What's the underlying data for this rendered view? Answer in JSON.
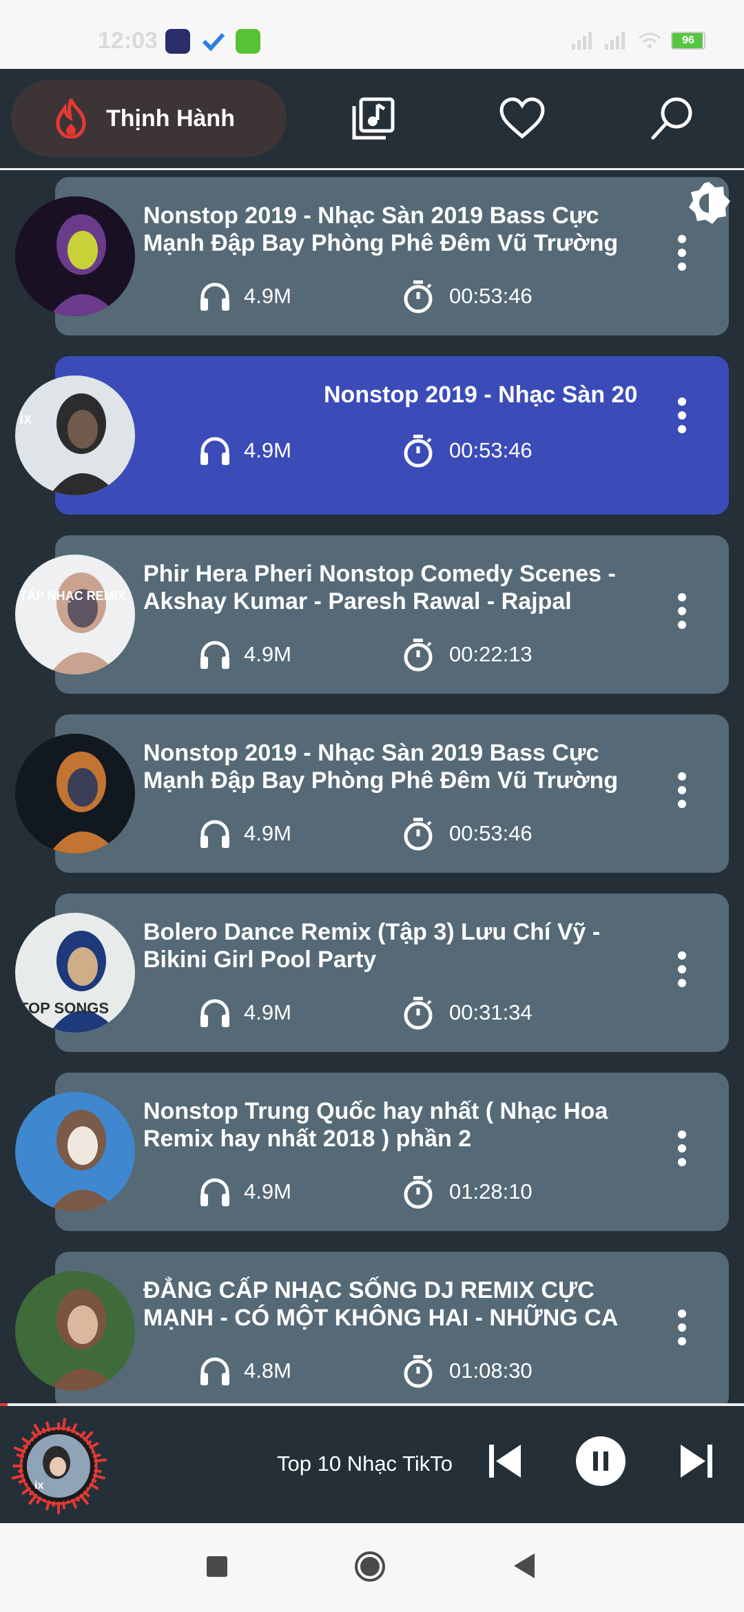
{
  "status_bar": {
    "time": "12:03",
    "battery": "96",
    "battery_level": 0.96,
    "apps": [
      "game-app-icon",
      "check-app-icon",
      "android-app-icon"
    ]
  },
  "header": {
    "active_tab": "Thịnh Hành",
    "icons": [
      "fire-icon",
      "music-library-icon",
      "heart-icon",
      "search-icon"
    ]
  },
  "songs": [
    {
      "title": "Nonstop 2019 - Nhạc Sàn 2019 Bass Cực Mạnh Đập Bay Phòng Phê Đêm Vũ Trường",
      "plays": "4.9M",
      "duration": "00:53:46",
      "active": false
    },
    {
      "title": "Nonstop 2019 - Nhạc Sàn 20",
      "plays": "4.9M",
      "duration": "00:53:46",
      "active": true
    },
    {
      "title": "Phir Hera Pheri Nonstop Comedy Scenes - Akshay Kumar - Paresh Rawal - Rajpal Yada...",
      "plays": "4.9M",
      "duration": "00:22:13",
      "active": false
    },
    {
      "title": "Nonstop 2019 - Nhạc Sàn 2019 Bass Cực Mạnh Đập Bay Phòng Phê Đêm Vũ Trường",
      "plays": "4.9M",
      "duration": "00:53:46",
      "active": false
    },
    {
      "title": "Bolero Dance Remix (Tập 3) Lưu Chí Vỹ - Bikini Girl Pool Party",
      "plays": "4.9M",
      "duration": "00:31:34",
      "active": false
    },
    {
      "title": "Nonstop Trung Quốc hay nhất ( Nhạc Hoa Remix hay nhất 2018 ) phần 2",
      "plays": "4.9M",
      "duration": "01:28:10",
      "active": false
    },
    {
      "title": "ĐẲNG CẤP NHẠC SỐNG DJ REMIX CỰC MẠNH - CÓ MỘT KHÔNG HAI - NHỮNG CA ...",
      "plays": "4.8M",
      "duration": "01:08:30",
      "active": false
    }
  ],
  "thumb_labels": [
    "",
    "ix",
    "TẬP NHẠC REMIX",
    "",
    "TOP SONGS",
    "",
    ""
  ],
  "player": {
    "now_playing": "Top 10 Nhạc TikTo",
    "progress": 0.01,
    "controls": [
      "previous-icon",
      "pause-icon",
      "next-icon"
    ]
  },
  "colors": {
    "background": "#242f37",
    "card": "#556a76",
    "active_card": "#3b4cb9",
    "accent_red": "#e53935",
    "tab_pill": "#3d3535"
  }
}
